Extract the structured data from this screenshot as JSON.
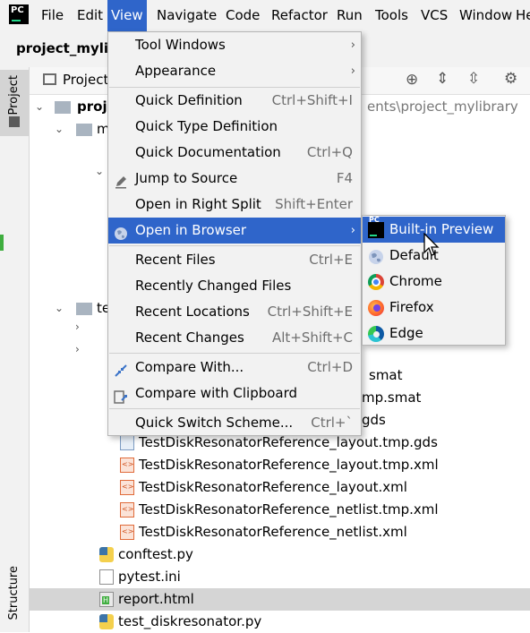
{
  "menubar": {
    "items": [
      {
        "label": "File"
      },
      {
        "label": "Edit"
      },
      {
        "label": "View"
      },
      {
        "label": "Navigate"
      },
      {
        "label": "Code"
      },
      {
        "label": "Refactor"
      },
      {
        "label": "Run"
      },
      {
        "label": "Tools"
      },
      {
        "label": "VCS"
      },
      {
        "label": "Window"
      },
      {
        "label": "He"
      }
    ],
    "active_index": 2,
    "accent": "#2f65ca"
  },
  "titlebar": {
    "project_name": "project_mylib"
  },
  "side_strip": {
    "project_tab": "Project",
    "structure_tab": "Structure"
  },
  "project_panel": {
    "title": "Project",
    "path_fragment": "ents\\project_mylibrary",
    "tree": [
      {
        "label": "proje"
      },
      {
        "label": "m"
      },
      {
        "label": "te"
      },
      {
        "label": "smat"
      },
      {
        "label": "mp.smat"
      },
      {
        "label": "gds"
      },
      {
        "label": "TestDiskResonatorReference_layout.tmp.gds"
      },
      {
        "label": "TestDiskResonatorReference_layout.tmp.xml"
      },
      {
        "label": "TestDiskResonatorReference_layout.xml"
      },
      {
        "label": "TestDiskResonatorReference_netlist.tmp.xml"
      },
      {
        "label": "TestDiskResonatorReference_netlist.xml"
      },
      {
        "label": "conftest.py"
      },
      {
        "label": "pytest.ini"
      },
      {
        "label": "report.html"
      },
      {
        "label": "test_diskresonator.py"
      }
    ]
  },
  "view_menu": {
    "items": [
      {
        "label": "Tool Windows",
        "shortcut": "",
        "submenu": true,
        "icon": ""
      },
      {
        "label": "Appearance",
        "shortcut": "",
        "submenu": true,
        "icon": ""
      },
      {
        "label": "Quick Definition",
        "shortcut": "Ctrl+Shift+I",
        "submenu": false,
        "icon": ""
      },
      {
        "label": "Quick Type Definition",
        "shortcut": "",
        "submenu": false,
        "icon": ""
      },
      {
        "label": "Quick Documentation",
        "shortcut": "Ctrl+Q",
        "submenu": false,
        "icon": ""
      },
      {
        "label": "Jump to Source",
        "shortcut": "F4",
        "submenu": false,
        "icon": "pencil-icon"
      },
      {
        "label": "Open in Right Split",
        "shortcut": "Shift+Enter",
        "submenu": false,
        "icon": ""
      },
      {
        "label": "Open in Browser",
        "shortcut": "",
        "submenu": true,
        "icon": "globe-icon"
      },
      {
        "label": "Recent Files",
        "shortcut": "Ctrl+E",
        "submenu": false,
        "icon": ""
      },
      {
        "label": "Recently Changed Files",
        "shortcut": "",
        "submenu": false,
        "icon": ""
      },
      {
        "label": "Recent Locations",
        "shortcut": "Ctrl+Shift+E",
        "submenu": false,
        "icon": ""
      },
      {
        "label": "Recent Changes",
        "shortcut": "Alt+Shift+C",
        "submenu": false,
        "icon": ""
      },
      {
        "label": "Compare With...",
        "shortcut": "Ctrl+D",
        "submenu": false,
        "icon": "compare-icon"
      },
      {
        "label": "Compare with Clipboard",
        "shortcut": "",
        "submenu": false,
        "icon": "clipboard-compare-icon"
      },
      {
        "label": "Quick Switch Scheme...",
        "shortcut": "Ctrl+`",
        "submenu": false,
        "icon": ""
      }
    ],
    "highlighted_index": 7
  },
  "browser_submenu": {
    "items": [
      {
        "label": "Built-in Preview",
        "icon": "pycharm-icon"
      },
      {
        "label": "Default",
        "icon": "globe-icon"
      },
      {
        "label": "Chrome",
        "icon": "chrome-icon"
      },
      {
        "label": "Firefox",
        "icon": "firefox-icon"
      },
      {
        "label": "Edge",
        "icon": "edge-icon"
      }
    ],
    "highlighted_index": 0
  }
}
